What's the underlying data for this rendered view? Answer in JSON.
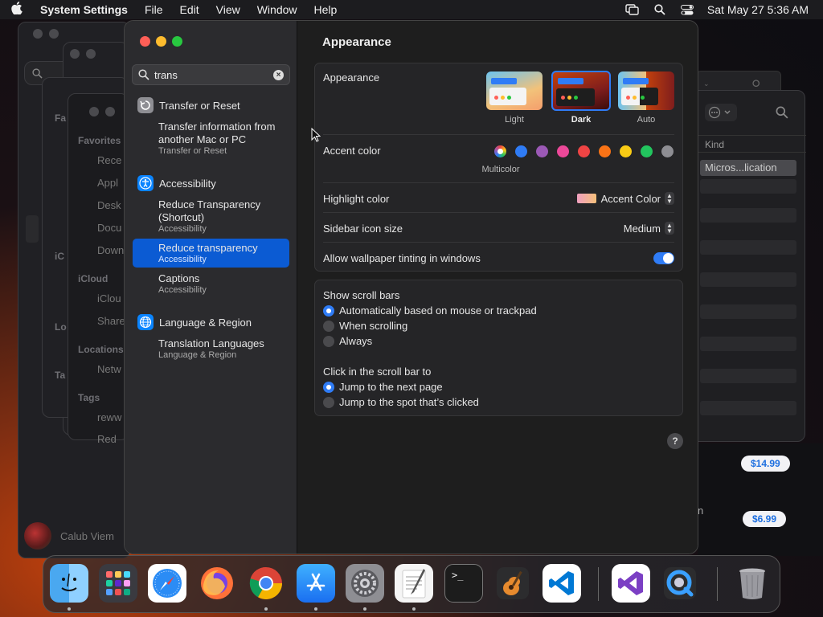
{
  "menubar": {
    "app_name": "System Settings",
    "items": [
      "File",
      "Edit",
      "View",
      "Window",
      "Help"
    ],
    "clock": "Sat May 27  5:36 AM"
  },
  "background": {
    "finder_sidebar": {
      "favorites_header": "Favorites",
      "favorites": [
        "Rece",
        "Appl",
        "Desk",
        "Docu",
        "Down"
      ],
      "icloud_header": "iCloud",
      "icloud": [
        "iClou",
        "Share"
      ],
      "locations_header": "Locations",
      "locations": [
        "Netw"
      ],
      "tags_header": "Tags",
      "tags": [
        "reww",
        "Red"
      ],
      "fragments": [
        "Fa",
        "iC",
        "Lo",
        "Ta"
      ]
    },
    "right_window": {
      "kind_header": "Kind",
      "selected_row": "Micros...lication"
    },
    "prices": [
      "$14.99",
      "$6.99"
    ],
    "fragment_n": "n",
    "user_name": "Calub Viem"
  },
  "search": {
    "value": "trans"
  },
  "results": {
    "section1": {
      "header": "Transfer or Reset",
      "items": [
        {
          "title": "Transfer information from another Mac or PC",
          "subtitle": "Transfer or Reset"
        }
      ]
    },
    "section2": {
      "header": "Accessibility",
      "items": [
        {
          "title": "Reduce Transparency (Shortcut)",
          "subtitle": "Accessibility"
        },
        {
          "title": "Reduce transparency",
          "subtitle": "Accessibility"
        },
        {
          "title": "Captions",
          "subtitle": "Accessibility"
        }
      ]
    },
    "section3": {
      "header": "Language & Region",
      "items": [
        {
          "title": "Translation Languages",
          "subtitle": "Language & Region"
        }
      ]
    }
  },
  "content": {
    "title": "Appearance",
    "appearance_label": "Appearance",
    "themes": [
      "Light",
      "Dark",
      "Auto"
    ],
    "selected_theme": "Dark",
    "accent_label": "Accent color",
    "accent_colors": [
      "#ffffff",
      "#2f7cf6",
      "#9b59b6",
      "#ec4899",
      "#ef4444",
      "#f97316",
      "#facc15",
      "#22c55e",
      "#8e8e93"
    ],
    "accent_selected_name": "Multicolor",
    "highlight_label": "Highlight color",
    "highlight_value": "Accent Color",
    "sidebar_icon_label": "Sidebar icon size",
    "sidebar_icon_value": "Medium",
    "wallpaper_tint_label": "Allow wallpaper tinting in windows",
    "wallpaper_tint_on": true,
    "scroll_bars_label": "Show scroll bars",
    "scroll_bar_options": [
      "Automatically based on mouse or trackpad",
      "When scrolling",
      "Always"
    ],
    "scroll_bar_selected": 0,
    "click_label": "Click in the scroll bar to",
    "click_options": [
      "Jump to the next page",
      "Jump to the spot that’s clicked"
    ],
    "click_selected": 0,
    "help": "?"
  },
  "colors": {
    "accent": "#2f7cf6",
    "selection": "#0b5bd3",
    "traffic_red": "#ff5f57",
    "traffic_yellow": "#febc2e",
    "traffic_green": "#28c840"
  },
  "dock": {
    "apps": [
      "finder-icon",
      "launchpad-icon",
      "safari-icon",
      "firefox-icon",
      "chrome-icon",
      "app-store-icon",
      "system-settings-icon",
      "textedit-icon",
      "terminal-icon",
      "garageband-icon",
      "vscode-icon",
      "visual-studio-icon",
      "quicktime-icon",
      "trash-icon"
    ],
    "terminal_glyph": ">_"
  }
}
